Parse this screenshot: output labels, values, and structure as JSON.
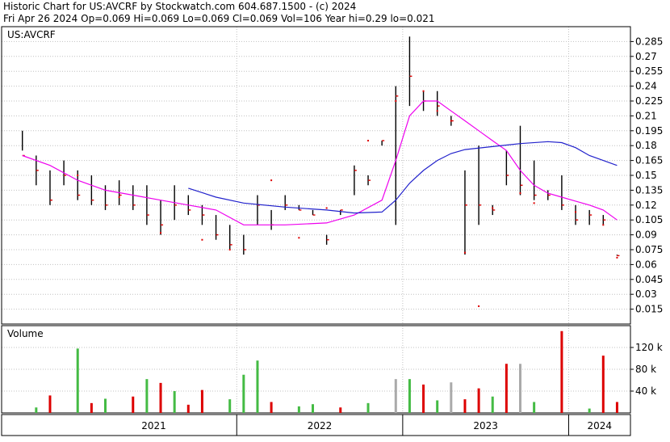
{
  "header": {
    "title": "Historic Chart for US:AVCRF by Stockwatch.com 604.687.1500 - (c) 2024",
    "summary": "Fri Apr 26 2024   Op=0.069  Hi=0.069  Lo=0.069  Cl=0.069  Vol=106  Year hi=0.29  lo=0.021"
  },
  "price_panel": {
    "symbol_label": "US:AVCRF",
    "y_ticks": [
      0.285,
      0.27,
      0.255,
      0.24,
      0.225,
      0.21,
      0.195,
      0.18,
      0.165,
      0.15,
      0.135,
      0.12,
      0.105,
      0.09,
      0.075,
      0.06,
      0.045,
      0.03,
      0.015
    ]
  },
  "volume_panel": {
    "label": "Volume",
    "y_ticks": [
      "120 k",
      "80 k",
      "40 k"
    ]
  },
  "x_axis": {
    "years": [
      "2021",
      "2022",
      "2023",
      "2024"
    ]
  },
  "colors": {
    "background": "#ffffff",
    "grid": "#c0c0c0",
    "price_bar": "#000000",
    "dot": "#dd0000",
    "ma_short": "#ee00ee",
    "ma_long": "#2222cc",
    "vol_up": "#44bb44",
    "vol_down": "#dd0000",
    "vol_flat": "#aaaaaa"
  },
  "chart_data": [
    {
      "type": "line",
      "title": "Historic Chart for US:AVCRF",
      "ylim": [
        0.0,
        0.3
      ],
      "x_domain": [
        "2020-08",
        "2024-04"
      ],
      "series": [
        {
          "kind": "ohlc",
          "points": [
            [
              "2020-09",
              0.195,
              0.175,
              0.17
            ],
            [
              "2020-10",
              0.17,
              0.14,
              0.155
            ],
            [
              "2020-11",
              0.155,
              0.12,
              0.125
            ],
            [
              "2020-12",
              0.165,
              0.14,
              0.15
            ],
            [
              "2021-01",
              0.155,
              0.125,
              0.13
            ],
            [
              "2021-02",
              0.15,
              0.12,
              0.125
            ],
            [
              "2021-03",
              0.14,
              0.115,
              0.12
            ],
            [
              "2021-04",
              0.145,
              0.12,
              0.13
            ],
            [
              "2021-05",
              0.14,
              0.115,
              0.12
            ],
            [
              "2021-06",
              0.14,
              0.1,
              0.11
            ],
            [
              "2021-07",
              0.125,
              0.09,
              0.1
            ],
            [
              "2021-08",
              0.14,
              0.105,
              0.12
            ],
            [
              "2021-09",
              0.13,
              0.11,
              0.115
            ],
            [
              "2021-10",
              0.12,
              0.1,
              0.11
            ],
            [
              "2021-11",
              0.11,
              0.085,
              0.09
            ],
            [
              "2021-12",
              0.1,
              0.075,
              0.08
            ],
            [
              "2022-01",
              0.09,
              0.07,
              0.075
            ],
            [
              "2022-02",
              0.13,
              0.1,
              0.12
            ],
            [
              "2022-03",
              0.115,
              0.095,
              0.1
            ],
            [
              "2022-04",
              0.13,
              0.115,
              0.12
            ],
            [
              "2022-05",
              0.12,
              0.115,
              0.115
            ],
            [
              "2022-06",
              0.115,
              0.11,
              0.11
            ],
            [
              "2022-07",
              0.09,
              0.08,
              0.085
            ],
            [
              "2022-08",
              0.115,
              0.11,
              0.115
            ],
            [
              "2022-09",
              0.16,
              0.13,
              0.155
            ],
            [
              "2022-10",
              0.15,
              0.14,
              0.145
            ],
            [
              "2022-11",
              0.185,
              0.18,
              0.185
            ],
            [
              "2022-12",
              0.24,
              0.1,
              0.23
            ],
            [
              "2023-01",
              0.29,
              0.22,
              0.25
            ],
            [
              "2023-02",
              0.235,
              0.215,
              0.225
            ],
            [
              "2023-03",
              0.235,
              0.21,
              0.22
            ],
            [
              "2023-04",
              0.21,
              0.2,
              0.205
            ],
            [
              "2023-05",
              0.155,
              0.07,
              0.12
            ],
            [
              "2023-06",
              0.18,
              0.1,
              0.12
            ],
            [
              "2023-07",
              0.12,
              0.11,
              0.115
            ],
            [
              "2023-08",
              0.175,
              0.14,
              0.15
            ],
            [
              "2023-09",
              0.2,
              0.13,
              0.14
            ],
            [
              "2023-10",
              0.165,
              0.125,
              0.13
            ],
            [
              "2023-11",
              0.135,
              0.125,
              0.13
            ],
            [
              "2023-12",
              0.15,
              0.115,
              0.12
            ],
            [
              "2024-01",
              0.12,
              0.1,
              0.105
            ],
            [
              "2024-02",
              0.115,
              0.1,
              0.11
            ],
            [
              "2024-03",
              0.11,
              0.1,
              0.105
            ],
            [
              "2024-04",
              0.07,
              0.069,
              0.069
            ]
          ]
        },
        {
          "kind": "dots",
          "points": [
            [
              "2021-01",
              0.15
            ],
            [
              "2021-04",
              0.128
            ],
            [
              "2021-07",
              0.092
            ],
            [
              "2021-10",
              0.085
            ],
            [
              "2021-12",
              0.075
            ],
            [
              "2022-03",
              0.145
            ],
            [
              "2022-05",
              0.087
            ],
            [
              "2022-07",
              0.117
            ],
            [
              "2022-10",
              0.185
            ],
            [
              "2022-12",
              0.225
            ],
            [
              "2023-02",
              0.235
            ],
            [
              "2023-03",
              0.215
            ],
            [
              "2023-04",
              0.205
            ],
            [
              "2023-05",
              0.072
            ],
            [
              "2023-06",
              0.018
            ],
            [
              "2023-07",
              0.117
            ],
            [
              "2023-09",
              0.132
            ],
            [
              "2023-10",
              0.122
            ],
            [
              "2024-01",
              0.113
            ],
            [
              "2024-03",
              0.1
            ],
            [
              "2024-04",
              0.067
            ]
          ]
        },
        {
          "name": "ma_short",
          "kind": "line",
          "points": [
            [
              "2020-09",
              0.17
            ],
            [
              "2020-11",
              0.16
            ],
            [
              "2021-01",
              0.145
            ],
            [
              "2021-03",
              0.135
            ],
            [
              "2021-05",
              0.13
            ],
            [
              "2021-07",
              0.125
            ],
            [
              "2021-09",
              0.12
            ],
            [
              "2021-11",
              0.115
            ],
            [
              "2022-01",
              0.1
            ],
            [
              "2022-04",
              0.1
            ],
            [
              "2022-07",
              0.102
            ],
            [
              "2022-09",
              0.11
            ],
            [
              "2022-11",
              0.125
            ],
            [
              "2022-12",
              0.165
            ],
            [
              "2023-01",
              0.21
            ],
            [
              "2023-02",
              0.225
            ],
            [
              "2023-03",
              0.225
            ],
            [
              "2023-04",
              0.215
            ],
            [
              "2023-05",
              0.205
            ],
            [
              "2023-06",
              0.195
            ],
            [
              "2023-07",
              0.185
            ],
            [
              "2023-08",
              0.175
            ],
            [
              "2023-09",
              0.155
            ],
            [
              "2023-10",
              0.14
            ],
            [
              "2023-11",
              0.132
            ],
            [
              "2023-12",
              0.128
            ],
            [
              "2024-01",
              0.124
            ],
            [
              "2024-02",
              0.12
            ],
            [
              "2024-03",
              0.115
            ],
            [
              "2024-04",
              0.105
            ]
          ]
        },
        {
          "name": "ma_long",
          "kind": "line",
          "points": [
            [
              "2021-09",
              0.137
            ],
            [
              "2021-11",
              0.128
            ],
            [
              "2022-01",
              0.122
            ],
            [
              "2022-04",
              0.118
            ],
            [
              "2022-07",
              0.115
            ],
            [
              "2022-09",
              0.112
            ],
            [
              "2022-11",
              0.113
            ],
            [
              "2022-12",
              0.125
            ],
            [
              "2023-01",
              0.142
            ],
            [
              "2023-02",
              0.155
            ],
            [
              "2023-03",
              0.165
            ],
            [
              "2023-04",
              0.172
            ],
            [
              "2023-05",
              0.176
            ],
            [
              "2023-07",
              0.179
            ],
            [
              "2023-09",
              0.182
            ],
            [
              "2023-11",
              0.184
            ],
            [
              "2023-12",
              0.183
            ],
            [
              "2024-01",
              0.178
            ],
            [
              "2024-02",
              0.17
            ],
            [
              "2024-03",
              0.165
            ],
            [
              "2024-04",
              0.16
            ]
          ]
        }
      ]
    },
    {
      "type": "bar",
      "title": "Volume",
      "ylim": [
        0,
        160000
      ],
      "bars": [
        [
          "2020-10",
          10000,
          "up"
        ],
        [
          "2020-11",
          32000,
          "down"
        ],
        [
          "2021-01",
          118000,
          "up"
        ],
        [
          "2021-02",
          18000,
          "down"
        ],
        [
          "2021-03",
          26000,
          "up"
        ],
        [
          "2021-05",
          30000,
          "down"
        ],
        [
          "2021-06",
          62000,
          "up"
        ],
        [
          "2021-07",
          55000,
          "down"
        ],
        [
          "2021-08",
          40000,
          "up"
        ],
        [
          "2021-09",
          15000,
          "down"
        ],
        [
          "2021-10",
          42000,
          "down"
        ],
        [
          "2021-12",
          25000,
          "up"
        ],
        [
          "2022-01",
          70000,
          "up"
        ],
        [
          "2022-02",
          96000,
          "up"
        ],
        [
          "2022-03",
          20000,
          "down"
        ],
        [
          "2022-05",
          12000,
          "up"
        ],
        [
          "2022-06",
          16000,
          "up"
        ],
        [
          "2022-08",
          10000,
          "down"
        ],
        [
          "2022-10",
          18000,
          "up"
        ],
        [
          "2022-12",
          62000,
          "flat"
        ],
        [
          "2023-01",
          62000,
          "up"
        ],
        [
          "2023-02",
          52000,
          "down"
        ],
        [
          "2023-03",
          23000,
          "up"
        ],
        [
          "2023-04",
          56000,
          "flat"
        ],
        [
          "2023-05",
          25000,
          "down"
        ],
        [
          "2023-06",
          45000,
          "down"
        ],
        [
          "2023-07",
          30000,
          "up"
        ],
        [
          "2023-08",
          90000,
          "down"
        ],
        [
          "2023-09",
          90000,
          "flat"
        ],
        [
          "2023-10",
          20000,
          "up"
        ],
        [
          "2023-12",
          150000,
          "down"
        ],
        [
          "2024-02",
          8000,
          "up"
        ],
        [
          "2024-03",
          105000,
          "down"
        ],
        [
          "2024-04",
          20000,
          "down"
        ]
      ]
    }
  ]
}
